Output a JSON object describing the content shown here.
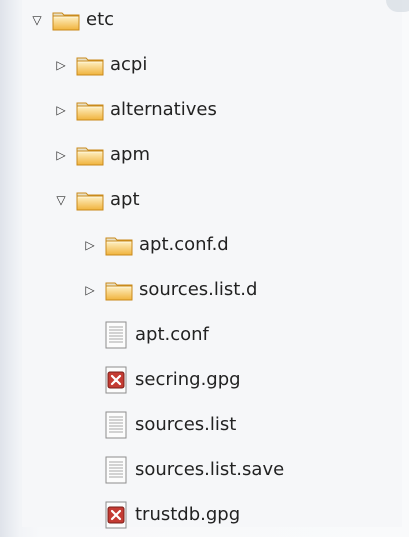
{
  "tree": [
    {
      "label": "etc",
      "type": "folder",
      "expanded": true,
      "depth": 0
    },
    {
      "label": "acpi",
      "type": "folder",
      "expanded": false,
      "depth": 1
    },
    {
      "label": "alternatives",
      "type": "folder",
      "expanded": false,
      "depth": 1
    },
    {
      "label": "apm",
      "type": "folder",
      "expanded": false,
      "depth": 1
    },
    {
      "label": "apt",
      "type": "folder",
      "expanded": true,
      "depth": 1
    },
    {
      "label": "apt.conf.d",
      "type": "folder",
      "expanded": false,
      "depth": 2
    },
    {
      "label": "sources.list.d",
      "type": "folder",
      "expanded": false,
      "depth": 2
    },
    {
      "label": "apt.conf",
      "type": "text-file",
      "depth": 2
    },
    {
      "label": "secring.gpg",
      "type": "binary-file",
      "depth": 2
    },
    {
      "label": "sources.list",
      "type": "text-file",
      "depth": 2
    },
    {
      "label": "sources.list.save",
      "type": "text-file",
      "depth": 2
    },
    {
      "label": "trustdb.gpg",
      "type": "binary-file",
      "depth": 2
    }
  ],
  "icons": {
    "expanded": "triangle-down",
    "collapsed": "triangle-right",
    "folder": "folder-icon",
    "text-file": "text-file-icon",
    "binary-file": "binary-file-icon"
  },
  "colors": {
    "folder_top": "#fff2c8",
    "folder_bottom": "#f0b33c",
    "folder_edge": "#c98a1b",
    "binary_red": "#c43b33"
  }
}
